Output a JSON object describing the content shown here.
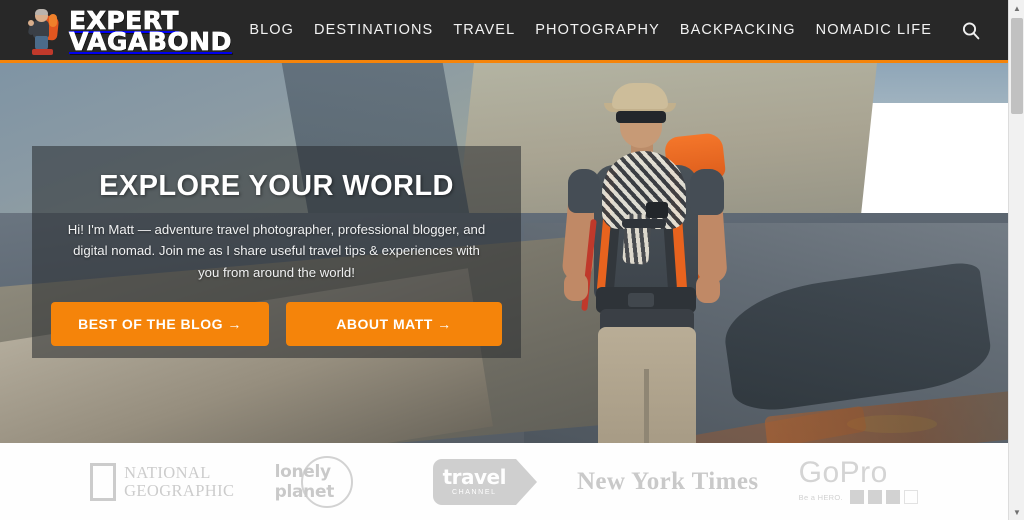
{
  "header": {
    "logo": {
      "line1": "EXPERT",
      "line2": "VAGABOND",
      "mascot_alt": "backpacker-mascot"
    },
    "nav": [
      {
        "label": "BLOG"
      },
      {
        "label": "DESTINATIONS"
      },
      {
        "label": "TRAVEL"
      },
      {
        "label": "PHOTOGRAPHY"
      },
      {
        "label": "BACKPACKING"
      },
      {
        "label": "NOMADIC LIFE"
      }
    ],
    "search_icon": "search-icon",
    "accent_color": "#f5840a",
    "background_color": "#282828"
  },
  "hero": {
    "title": "EXPLORE YOUR WORLD",
    "subtitle": "Hi! I'm Matt — adventure travel photographer, professional blogger, and digital nomad. Join me as I share useful travel tips & experiences with you from around the world!",
    "buttons": [
      {
        "label": "BEST OF THE BLOG →",
        "color": "#f5840a"
      },
      {
        "label": "ABOUT MATT →",
        "color": "#f5840a"
      }
    ],
    "image_alt": "hiker-with-orange-backpack-on-mountain-ridge"
  },
  "press_logos": [
    {
      "name": "national-geographic",
      "line1": "NATIONAL",
      "line2": "GEOGRAPHIC"
    },
    {
      "name": "lonely-planet",
      "text": "lonely planet"
    },
    {
      "name": "travel-channel",
      "text": "travel",
      "subtext": "CHANNEL"
    },
    {
      "name": "new-york-times",
      "text": "New York Times"
    },
    {
      "name": "gopro",
      "text": "GoPro",
      "tagline": "Be a HERO."
    }
  ],
  "scrollbar": {
    "up_arrow": "▲",
    "down_arrow": "▼"
  }
}
